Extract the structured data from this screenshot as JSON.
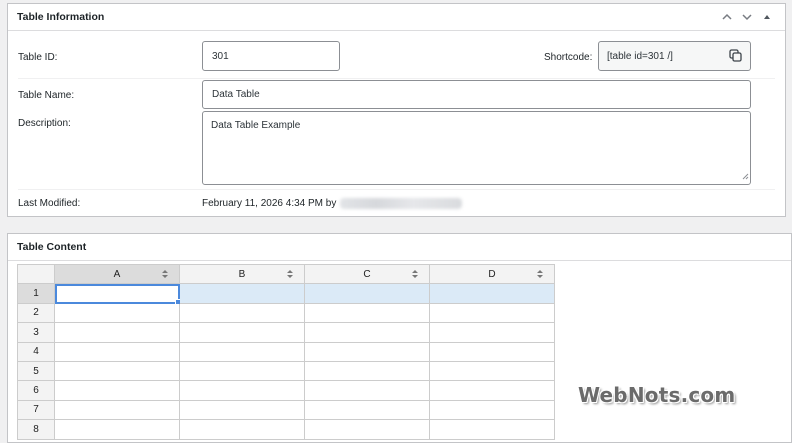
{
  "table_info": {
    "title": "Table Information",
    "id_label": "Table ID:",
    "id_value": "301",
    "shortcode_label": "Shortcode:",
    "shortcode_value": "[table id=301 /]",
    "name_label": "Table Name:",
    "name_value": "Data Table",
    "description_label": "Description:",
    "description_value": "Data Table Example",
    "modified_label": "Last Modified:",
    "modified_value": "February 11, 2026 4:34 PM by"
  },
  "table_content": {
    "title": "Table Content",
    "columns": [
      "A",
      "B",
      "C",
      "D"
    ],
    "rows": [
      "1",
      "2",
      "3",
      "4",
      "5",
      "6",
      "7",
      "8"
    ],
    "selected_row": 1
  },
  "icons": {
    "move_up": "chevron-up-icon",
    "move_down": "chevron-down-icon",
    "toggle": "triangle-up-icon",
    "copy": "copy-icon",
    "sort": "sort-arrows-icon"
  },
  "colors": {
    "accent": "#4b89dc",
    "selected_row": "#dbeaf7",
    "border": "#c3c4c7"
  },
  "watermark": "WebNots.com"
}
